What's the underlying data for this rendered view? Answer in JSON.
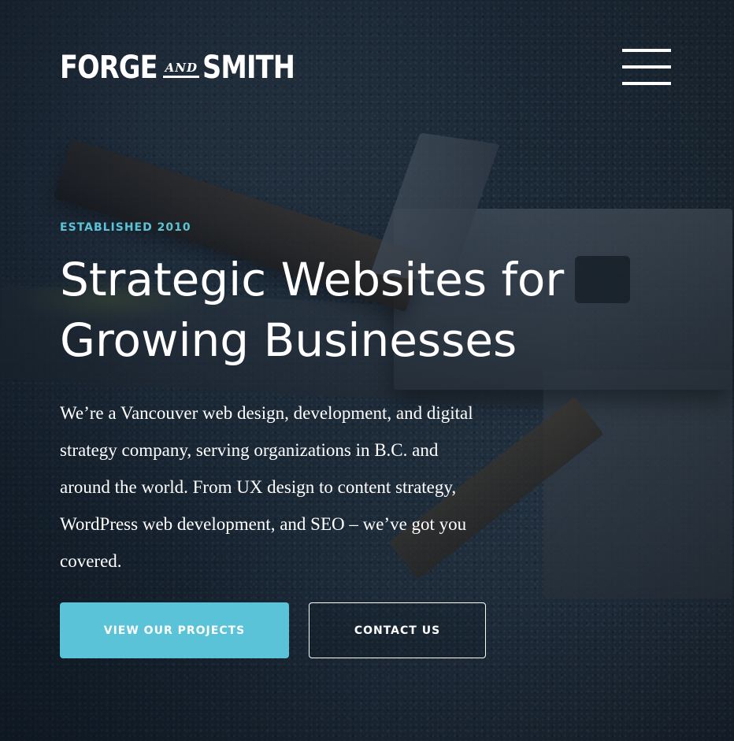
{
  "header": {
    "logo": {
      "word_first": "FORGE",
      "word_and": "AND",
      "word_last": "SMITH"
    },
    "menu_icon": "hamburger-menu-icon"
  },
  "hero": {
    "eyebrow": "ESTABLISHED 2010",
    "headline_line1": "Strategic Websites for",
    "headline_line2": "Growing Businesses",
    "intro": "We’re a Vancouver web design, development, and digital strategy company, serving organizations in B.C. and around the world. From UX design to content strategy, WordPress web development, and SEO – we’ve got you covered.",
    "buttons": {
      "primary_label": "VIEW OUR PROJECTS",
      "secondary_label": "CONTACT US"
    }
  },
  "colors": {
    "accent": "#5bc3d8",
    "eyebrow": "#5cc3d6",
    "text": "#ffffff",
    "background": "#1d2b3a"
  }
}
